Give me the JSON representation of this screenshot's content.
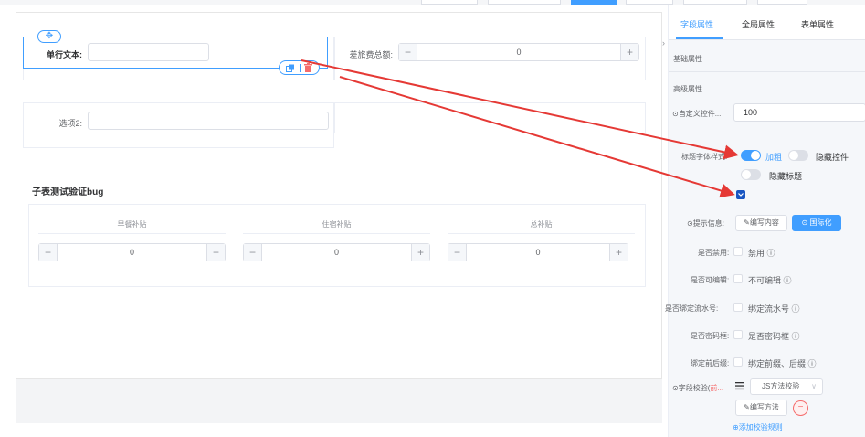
{
  "top_buttons": [
    {
      "active": false
    },
    {
      "active": false
    },
    {
      "active": true
    },
    {
      "active": false
    },
    {
      "active": false
    },
    {
      "active": false
    }
  ],
  "canvas": {
    "widget_single_text": {
      "label": "单行文本:",
      "value": ""
    },
    "widget_travel_total": {
      "label": "差旅费总额:",
      "value": "0"
    },
    "widget_option2": {
      "label": "选项2:",
      "value": ""
    },
    "drag_handle": "✥",
    "subtable": {
      "title": "子表测试验证bug",
      "columns": [
        {
          "header": "早餐补贴",
          "value": "0"
        },
        {
          "header": "住宿补贴",
          "value": "0"
        },
        {
          "header": "总补贴",
          "value": "0"
        }
      ],
      "minus": "−",
      "plus": "+"
    }
  },
  "panel": {
    "collapse_arrow": "›",
    "tabs": [
      {
        "label": "字段属性",
        "active": true
      },
      {
        "label": "全局属性",
        "active": false
      },
      {
        "label": "表单属性",
        "active": false
      }
    ],
    "sections": {
      "basic": "基础属性",
      "advanced": "高级属性"
    },
    "custom_control": {
      "label": "⊙自定义控件...",
      "value": "100"
    },
    "label_style": {
      "label": "标题字体样式:",
      "bold_label": "加粗",
      "bold_on": true,
      "hide_control_label": "隐藏控件",
      "hide_control_on": false,
      "hide_title_label": "隐藏标题",
      "hide_title_on": false
    },
    "highlight_checkbox_checked": true,
    "tip": {
      "label": "⊙提示信息:",
      "edit_button": "✎编写内容",
      "i18n_button": "⊙ 国际化"
    },
    "checkboxes": [
      {
        "label": "是否禁用:",
        "text": "禁用 ⓘ",
        "checked": false
      },
      {
        "label": "是否可编辑:",
        "text": "不可编辑 ⓘ",
        "checked": false
      },
      {
        "label": "是否绑定流水号:",
        "text": "绑定流水号 ⓘ",
        "checked": false
      },
      {
        "label": "是否密码框:",
        "text": "是否密码框 ⓘ",
        "checked": false
      },
      {
        "label": "绑定前后缀:",
        "text": "绑定前缀、后缀 ⓘ",
        "checked": false
      }
    ],
    "validation": {
      "label": "⊙字段校验(",
      "label_red": "前...",
      "select_value": "JS方法校验",
      "select_arrow": "∨",
      "edit_method": "✎编写方法",
      "remove": "−",
      "add_rule": "⊕添加校验规则"
    }
  },
  "colors": {
    "accent": "#409eff",
    "arrow": "#e53935",
    "checkbox_checked": "#1a56c2",
    "danger": "#f56c6c"
  }
}
